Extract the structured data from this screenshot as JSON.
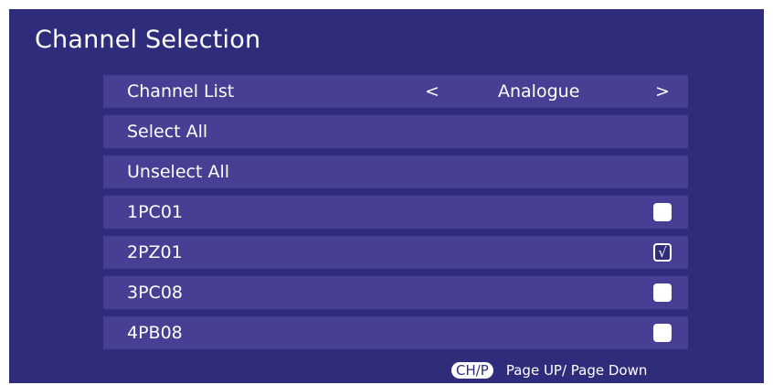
{
  "screen": {
    "title": "Channel Selection",
    "colors": {
      "panel_bg": "#2f2c7c",
      "row_bg": "#463f94",
      "text": "#ffffff"
    }
  },
  "channel_list": {
    "label": "Channel List",
    "value": "Analogue",
    "prev_icon": "chevron-left-icon",
    "next_icon": "chevron-right-icon",
    "prev_glyph": "<",
    "next_glyph": ">"
  },
  "actions": {
    "select_all": "Select All",
    "unselect_all": "Unselect All"
  },
  "channels": [
    {
      "name": "1PC01",
      "checked": false
    },
    {
      "name": "2PZ01",
      "checked": true
    },
    {
      "name": "3PC08",
      "checked": false
    },
    {
      "name": "4PB08",
      "checked": false
    }
  ],
  "check_glyph": "√",
  "footer": {
    "key": "CH/P",
    "hint": "Page UP/ Page Down"
  }
}
